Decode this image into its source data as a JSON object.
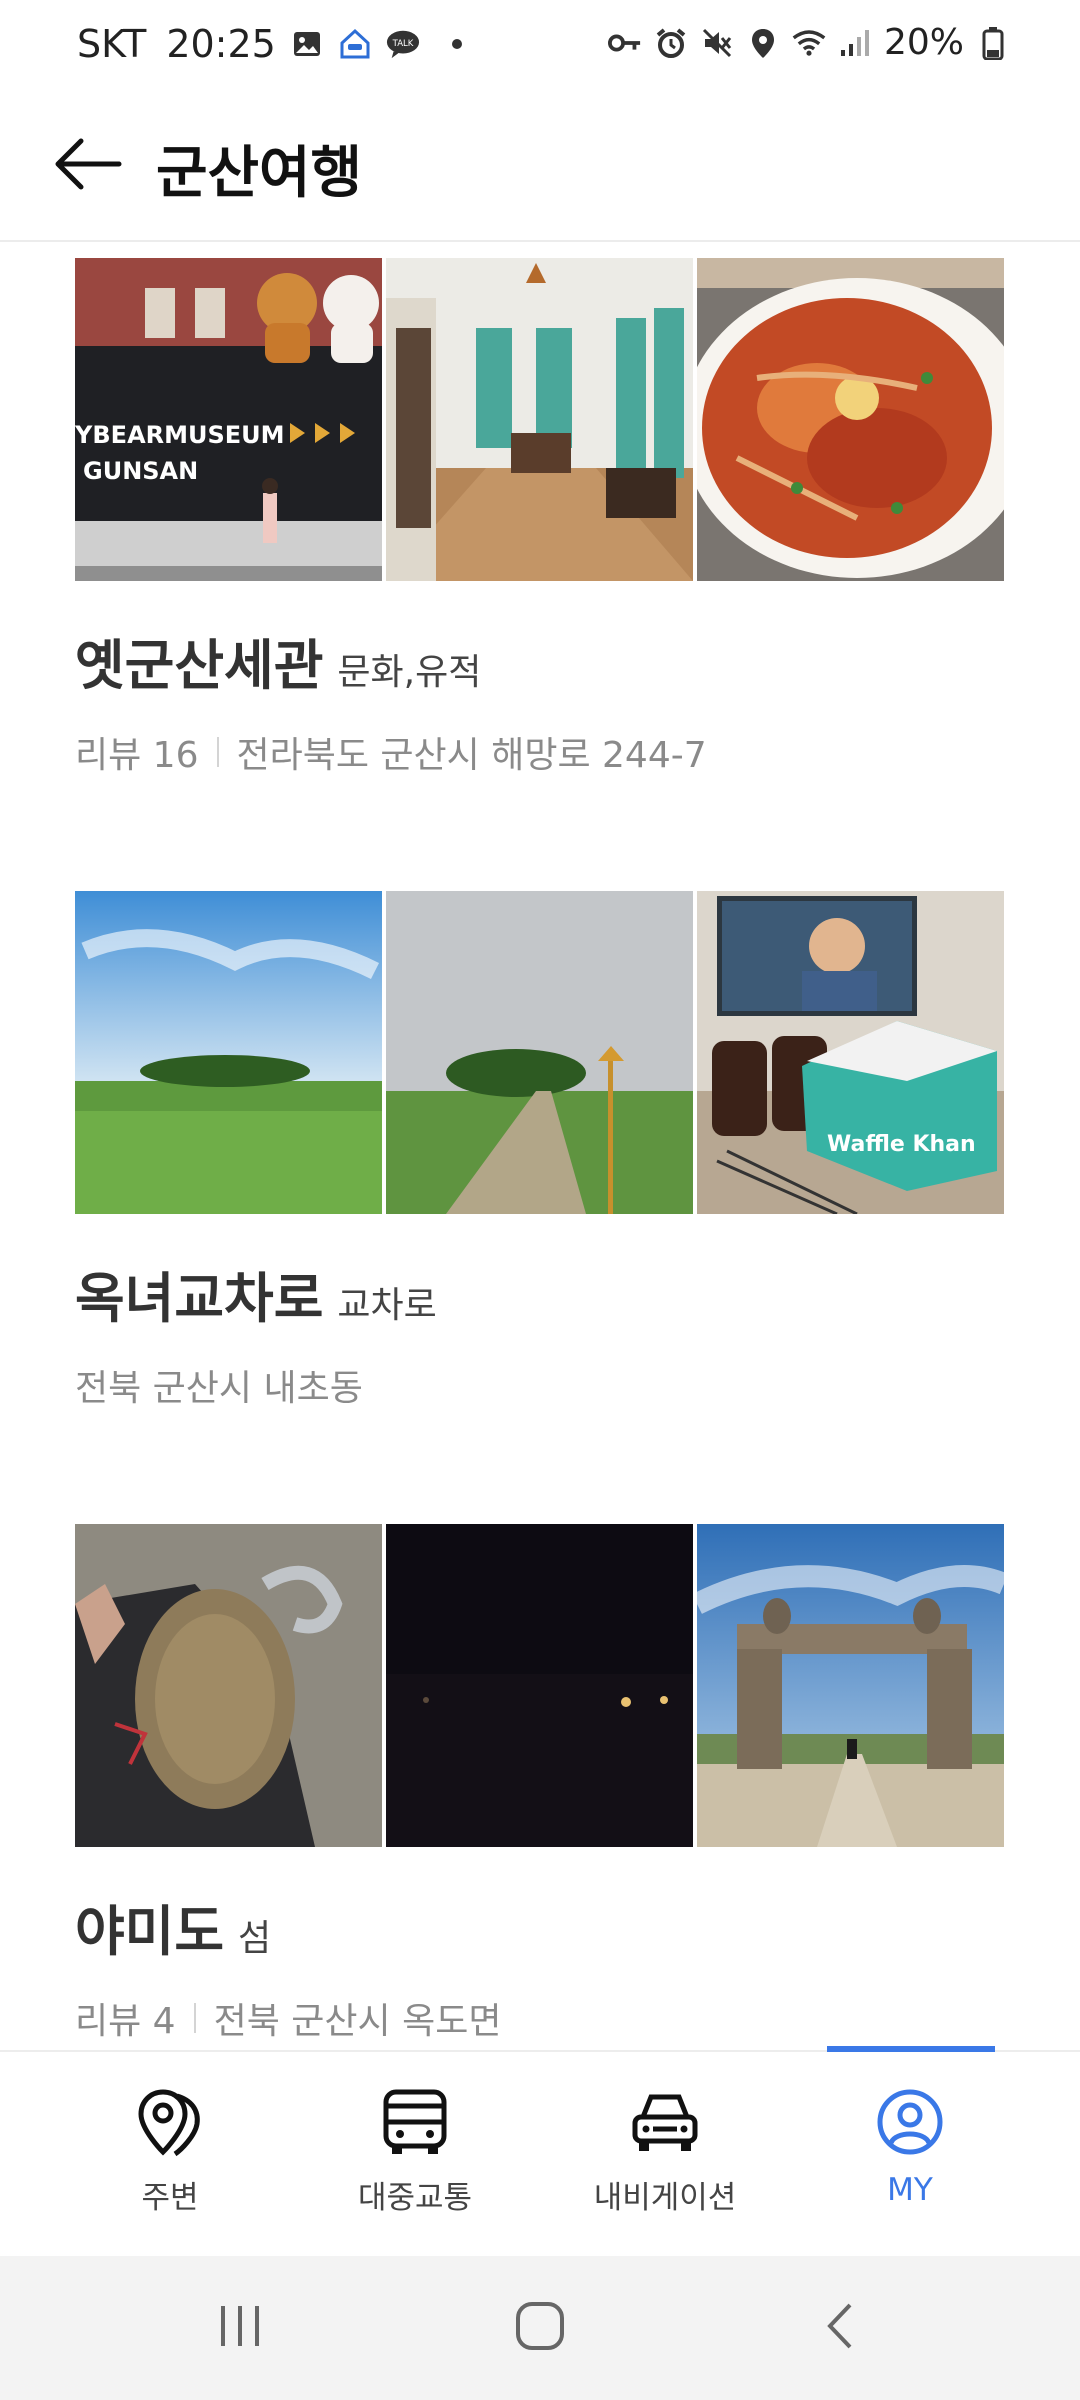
{
  "status_bar": {
    "carrier": "SKT",
    "time": "20:25",
    "battery": "20%",
    "left_icons": [
      "gallery-icon",
      "home-notification-icon",
      "talk-icon"
    ],
    "right_icons": [
      "key-icon",
      "alarm-icon",
      "mute-icon",
      "location-icon",
      "wifi-icon",
      "signal-icon",
      "battery-icon"
    ]
  },
  "header": {
    "title": "군산여행"
  },
  "places": [
    {
      "name": "옛군산세관",
      "category": "문화,유적",
      "review": "리뷰 16",
      "address": "전라북도 군산시 해망로 244-7",
      "photo_text": [
        "YBEARMUSEUM",
        "GUNSAN"
      ]
    },
    {
      "name": "옥녀교차로",
      "category": "교차로",
      "review": "",
      "address": "전북 군산시 내초동",
      "photo_text": [
        "Waffle Khan"
      ]
    },
    {
      "name": "야미도",
      "category": "섬",
      "review": "리뷰 4",
      "address": "전북 군산시 옥도면",
      "photo_text": []
    }
  ],
  "bottom_nav": {
    "items": [
      {
        "label": "주변",
        "icon": "map-pin-icon"
      },
      {
        "label": "대중교통",
        "icon": "bus-icon"
      },
      {
        "label": "내비게이션",
        "icon": "car-icon"
      },
      {
        "label": "MY",
        "icon": "user-icon"
      }
    ],
    "active_index": 3
  },
  "colors": {
    "accent": "#3a78e7",
    "meta_text": "#8a8a8a",
    "divider": "#ececec"
  }
}
